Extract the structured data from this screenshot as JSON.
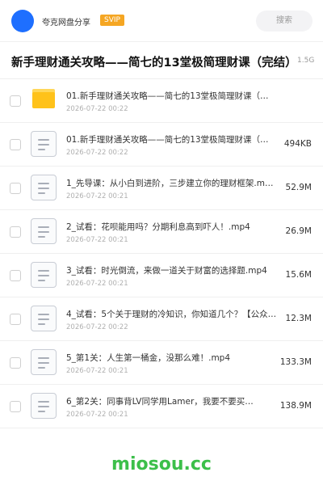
{
  "header": {
    "user_name": "夸克网盘分享",
    "vip_badge": "SVIP",
    "search_placeholder": "搜索"
  },
  "share": {
    "title": "新手理财通关攻略——简七的13堂极简理财课（完结）",
    "size": "1.5G"
  },
  "files": [
    {
      "type": "folder",
      "name": "01.新手理财通关攻略——简七的13堂极简理财课（…",
      "date": "2026-07-22 00:22",
      "size": ""
    },
    {
      "type": "file",
      "name": "01.新手理财通关攻略——简七的13堂极简理财课（…",
      "date": "2026-07-22 00:22",
      "size": "494KB"
    },
    {
      "type": "file",
      "name": "1_先导课：从小白到进阶，三步建立你的理财框架.m…",
      "date": "2026-07-22 00:21",
      "size": "52.9M"
    },
    {
      "type": "file",
      "name": "2_试看：花呗能用吗？分期利息高到吓人！.mp4",
      "date": "2026-07-22 00:21",
      "size": "26.9M"
    },
    {
      "type": "file",
      "name": "3_试看：时光倒流，来做一道关于财富的选择题.mp4",
      "date": "2026-07-22 00:21",
      "size": "15.6M"
    },
    {
      "type": "file",
      "name": "4_试看：5个关于理财的冷知识，你知道几个？【公众…",
      "date": "2026-07-22 00:22",
      "size": "12.3M"
    },
    {
      "type": "file",
      "name": "5_第1关：人生第一桶金，没那么难！.mp4",
      "date": "2026-07-22 00:21",
      "size": "133.3M"
    },
    {
      "type": "file",
      "name": "6_第2关：同事背LV同学用Lamer，我要不要买…",
      "date": "2026-07-22 00:21",
      "size": "138.9M"
    }
  ],
  "watermark": "miosou.cc",
  "colors": {
    "avatar": "#1e6fff",
    "vip_badge": "#f5a623",
    "folder": "#ffc21a",
    "watermark": "#3cbf4a"
  }
}
